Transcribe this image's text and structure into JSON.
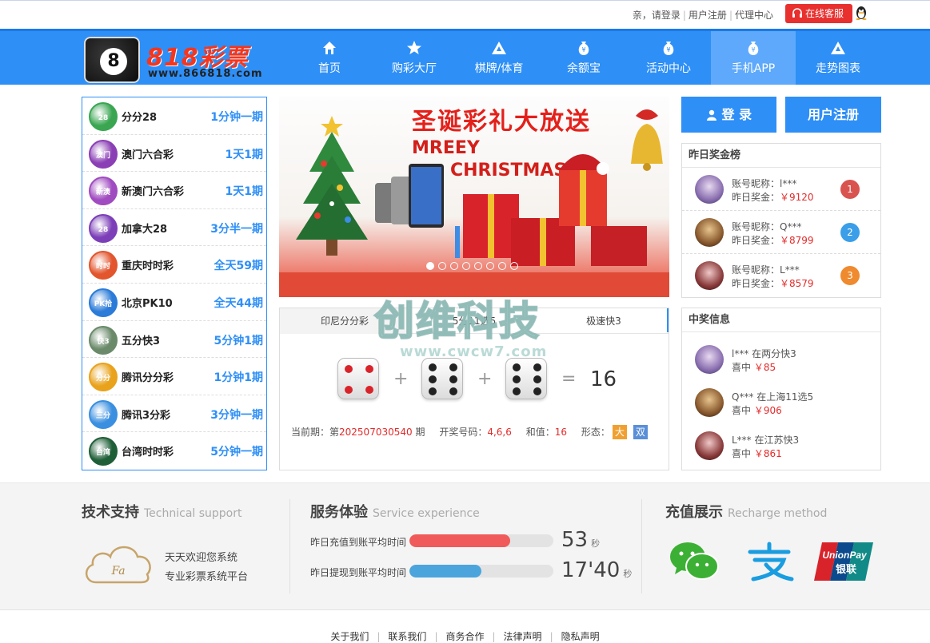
{
  "topbar": {
    "greeting": "亲，请登录",
    "register": "用户注册",
    "agent": "代理中心",
    "service": "在线客服"
  },
  "nav": {
    "brand": "818彩票",
    "url": "www.866818.com",
    "items": [
      {
        "label": "首页",
        "icon": "home-icon"
      },
      {
        "label": "购彩大厅",
        "icon": "star-icon"
      },
      {
        "label": "棋牌/体育",
        "icon": "triangle-icon"
      },
      {
        "label": "余额宝",
        "icon": "money-bag-icon"
      },
      {
        "label": "活动中心",
        "icon": "money-bag-icon"
      },
      {
        "label": "手机APP",
        "icon": "money-bag-icon"
      },
      {
        "label": "走势图表",
        "icon": "triangle-icon"
      }
    ],
    "active_index": 5
  },
  "games": [
    {
      "name": "分分28",
      "period": "1分钟一期",
      "badge": "28",
      "color": "#3aa652"
    },
    {
      "name": "澳门六合彩",
      "period": "1天1期",
      "badge": "澳门",
      "color": "#8b3fb5"
    },
    {
      "name": "新澳门六合彩",
      "period": "1天1期",
      "badge": "新澳",
      "color": "#a04bc0"
    },
    {
      "name": "加拿大28",
      "period": "3分半一期",
      "badge": "28",
      "color": "#7c3fb8"
    },
    {
      "name": "重庆时时彩",
      "period": "全天59期",
      "badge": "时时",
      "color": "#e2552d"
    },
    {
      "name": "北京PK10",
      "period": "全天44期",
      "badge": "PK拾",
      "color": "#2b7bd8"
    },
    {
      "name": "五分快3",
      "period": "5分钟1期",
      "badge": "快3",
      "color": "#6a8a6a"
    },
    {
      "name": "腾讯分分彩",
      "period": "1分钟1期",
      "badge": "分分",
      "color": "#e9a21b"
    },
    {
      "name": "腾讯3分彩",
      "period": "3分钟一期",
      "badge": "三分",
      "color": "#3a8fe0"
    },
    {
      "name": "台湾时时彩",
      "period": "5分钟一期",
      "badge": "台湾",
      "color": "#1f5f38"
    }
  ],
  "banner": {
    "title": "圣诞彩礼大放送",
    "line1": "MREEY",
    "line2": "CHRISTMAS",
    "slides": 8,
    "current_slide": 0
  },
  "draw": {
    "tabs": [
      "印尼分分彩",
      "5分11选5",
      "极速快3"
    ],
    "active_tab": 0,
    "dice": [
      4,
      6,
      6
    ],
    "plus": "+",
    "equals": "=",
    "sum": "16",
    "period_label": "当前期：第",
    "period": "202507030540",
    "period_suffix": "期",
    "code_label": "开奖号码：",
    "code": "4,6,6",
    "sum_label": "和值：",
    "sum_value": "16",
    "form_label": "形态：",
    "form_big": "大",
    "form_even": "双"
  },
  "watermark": {
    "text": "创维科技",
    "url": "www.cwcw7.com"
  },
  "auth": {
    "login": "登 录",
    "register": "用户注册"
  },
  "ranking": {
    "title": "昨日奖金榜",
    "rows": [
      {
        "name_label": "账号昵称：",
        "name": "l***",
        "prize_label": "昨日奖金：",
        "prize": "￥9120",
        "rank": "1",
        "rank_color": "#d9534f"
      },
      {
        "name_label": "账号昵称：",
        "name": "Q***",
        "prize_label": "昨日奖金：",
        "prize": "￥8799",
        "rank": "2",
        "rank_color": "#3a9ee8"
      },
      {
        "name_label": "账号昵称：",
        "name": "L***",
        "prize_label": "昨日奖金：",
        "prize": "￥8579",
        "rank": "3",
        "rank_color": "#ef8a2e"
      }
    ]
  },
  "winners": {
    "title": "中奖信息",
    "rows": [
      {
        "text": "l*** 在两分快3",
        "prize_label": "喜中",
        "prize": "￥85"
      },
      {
        "text": "Q*** 在上海11选5",
        "prize_label": "喜中",
        "prize": "￥906"
      },
      {
        "text": "L*** 在江苏快3",
        "prize_label": "喜中",
        "prize": "￥861"
      }
    ]
  },
  "footer": {
    "tech_title": "技术支持",
    "tech_en": "Technical support",
    "tech_line1": "天天欢迎您系统",
    "tech_line2": "专业彩票系统平台",
    "tech_logo": "Fa",
    "svc_title": "服务体验",
    "svc_en": "Service experience",
    "svc_rows": [
      {
        "label": "昨日充值到账平均时间",
        "value": "53",
        "unit": "秒",
        "fill": 0.7,
        "color": "#f05a5a"
      },
      {
        "label": "昨日提现到账平均时间",
        "value": "17'40",
        "unit": "秒",
        "fill": 0.5,
        "color": "#4ba5dc"
      }
    ],
    "pay_title": "充值展示",
    "pay_en": "Recharge method",
    "pay_methods": [
      "wechat-icon",
      "alipay-icon",
      "unionpay-icon"
    ],
    "unionpay_text1": "UnionPay",
    "unionpay_text2": "银联",
    "links": [
      "关于我们",
      "联系我们",
      "商务合作",
      "法律声明",
      "隐私声明"
    ]
  }
}
